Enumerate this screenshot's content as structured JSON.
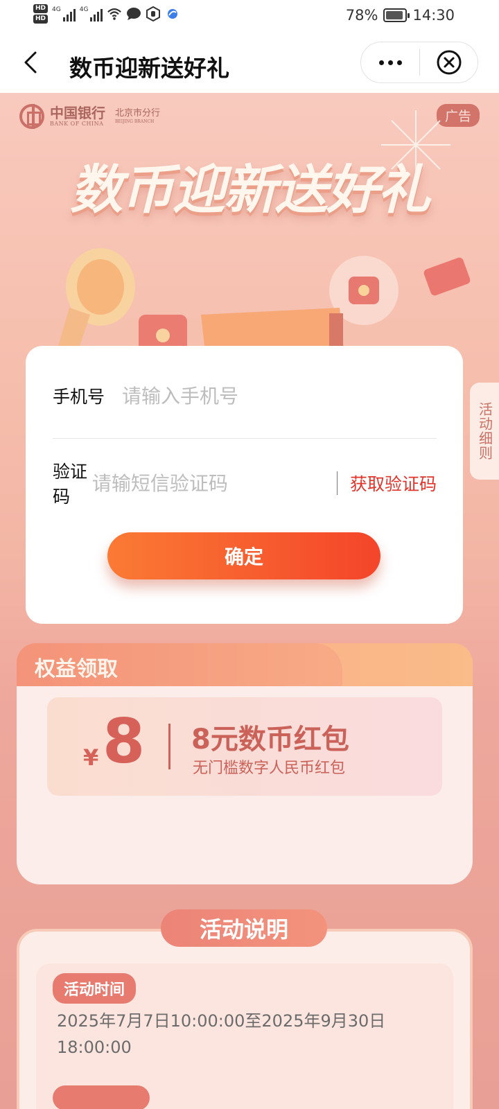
{
  "status_bar": {
    "hd1": "HD",
    "hd2": "HD",
    "sig1_label": "4G",
    "sig2_label": "4G",
    "battery": "78%",
    "battery_level": 0.78,
    "time": "14:30"
  },
  "nav": {
    "title": "数币迎新送好礼"
  },
  "banner": {
    "bank_cn": "中国银行",
    "bank_en": "BANK OF CHINA",
    "branch_cn": "北京市分行",
    "branch_en": "BEIJING BRANCH",
    "ad_tag": "广告",
    "hero_title": "数币迎新送好礼",
    "rules_tab": "活动细则"
  },
  "modal": {
    "phone_label": "手机号",
    "phone_placeholder": "请输入手机号",
    "code_label": "验证码",
    "code_placeholder": "请输短信验证码",
    "get_code": "获取验证码",
    "confirm": "确定"
  },
  "benefit": {
    "label": "权益领取",
    "yen": "¥",
    "amount": "8",
    "title": "8元数币红包",
    "subtitle": "无门槛数字人民币红包"
  },
  "activity": {
    "title": "活动说明",
    "time_label": "活动时间",
    "time_text": "2025年7月7日10:00:00至2025年9月30日18:00:00"
  },
  "colors": {
    "accent": "#e2342a",
    "confirm_start": "#fb7a34",
    "confirm_end": "#f4452a"
  }
}
